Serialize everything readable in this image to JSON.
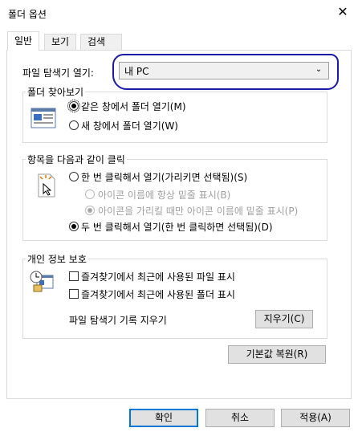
{
  "window": {
    "title": "폴더 옵션",
    "close_glyph": "✕"
  },
  "tabs": [
    {
      "label": "일반",
      "active": true
    },
    {
      "label": "보기",
      "active": false
    },
    {
      "label": "검색",
      "active": false
    }
  ],
  "open_explorer": {
    "label": "파일 탐색기 열기:",
    "value": "내 PC",
    "arrow": "⌄"
  },
  "browse_folders": {
    "title": "폴더 찾아보기",
    "options": [
      {
        "label": "같은 창에서 폴더 열기(M)",
        "selected": true
      },
      {
        "label": "새 창에서 폴더 열기(W)",
        "selected": false
      }
    ]
  },
  "click_items": {
    "title": "항목을 다음과 같이 클릭",
    "single_click": {
      "label": "한 번 클릭해서 열기(가리키면 선택됨)(S)",
      "selected": false
    },
    "sub_options": [
      {
        "label": "아이콘 이름에 항상 밑줄 표시(B)",
        "selected": false,
        "disabled": true
      },
      {
        "label": "아이콘을 가리킬 때만 아이콘 이름에 밑줄 표시(P)",
        "selected": true,
        "disabled": true
      }
    ],
    "double_click": {
      "label": "두 번 클릭해서 열기(한 번 클릭하면 선택됨)(D)",
      "selected": true
    }
  },
  "privacy": {
    "title": "개인 정보 보호",
    "checks": [
      {
        "label": "즐겨찾기에서 최근에 사용된 파일 표시",
        "checked": false
      },
      {
        "label": "즐겨찾기에서 최근에 사용된 폴더 표시",
        "checked": false
      }
    ],
    "clear_label": "파일 탐색기 기록 지우기",
    "clear_button": "지우기(C)"
  },
  "restore_button": "기본값 복원(R)",
  "footer": {
    "ok": "확인",
    "cancel": "취소",
    "apply": "적용(A)"
  },
  "colors": {
    "annotation": "#1a1aa8",
    "focus": "#0078d7"
  }
}
